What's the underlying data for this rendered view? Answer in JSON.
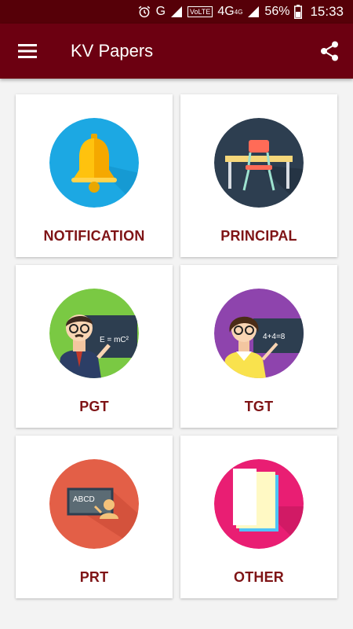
{
  "status_bar": {
    "network_g": "G",
    "volte": "VoLTE",
    "network_4g": "4G",
    "network_4g_super": "4G",
    "battery": "56%",
    "time": "15:33"
  },
  "app_bar": {
    "title": "KV Papers",
    "menu_icon": "hamburger-menu-icon",
    "share_icon": "share-icon"
  },
  "menu": [
    {
      "label": "NOTIFICATION",
      "icon": "bell-icon"
    },
    {
      "label": "PRINCIPAL",
      "icon": "desk-chair-icon"
    },
    {
      "label": "PGT",
      "icon": "male-teacher-icon",
      "board_text": "E = mC²"
    },
    {
      "label": "TGT",
      "icon": "female-teacher-icon",
      "board_text": "4+4=8"
    },
    {
      "label": "PRT",
      "icon": "blackboard-icon",
      "board_text": "ABCD"
    },
    {
      "label": "OTHER",
      "icon": "papers-icon"
    }
  ],
  "colors": {
    "status_bar": "#560008",
    "app_bar": "#6c0011",
    "label": "#7f1416"
  }
}
